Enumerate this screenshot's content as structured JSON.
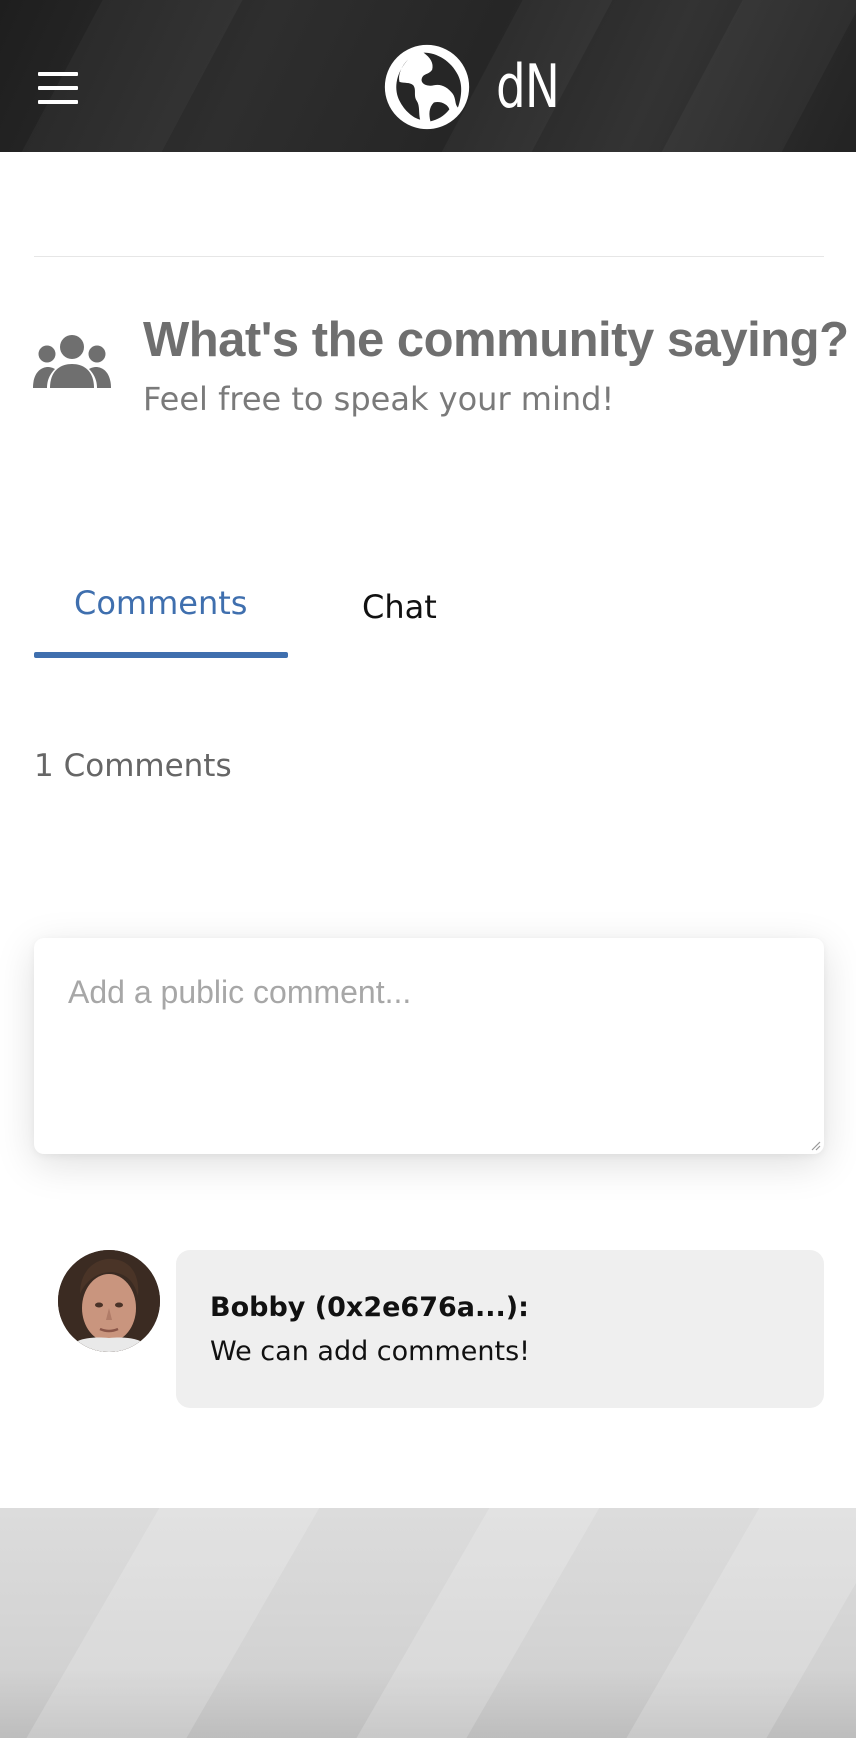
{
  "header": {
    "menu_icon": "hamburger-menu-icon",
    "logo_icon": "globe-icon",
    "logo_text": "dN"
  },
  "community": {
    "icon": "users-group-icon",
    "title": "What's the community saying?",
    "subtitle": "Feel free to speak your mind!"
  },
  "tabs": [
    {
      "label": "Comments",
      "active": true
    },
    {
      "label": "Chat",
      "active": false
    }
  ],
  "comments_count_label": "1 Comments",
  "comment_box": {
    "placeholder": "Add a public comment...",
    "value": ""
  },
  "comments": [
    {
      "author": "Bobby (0x2e676a...):",
      "text": "We can add comments!"
    }
  ],
  "colors": {
    "accent": "#3f6fae",
    "header_bg": "#2a2a2a",
    "bubble_bg": "#efefef",
    "title_gray": "#6f6f6f"
  }
}
